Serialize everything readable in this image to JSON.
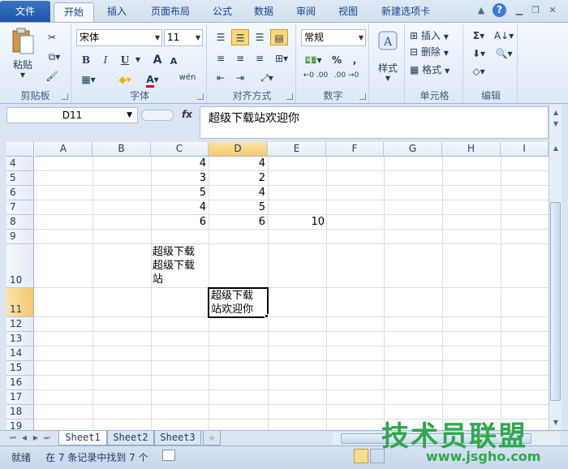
{
  "ribbon_tabs": [
    "文件",
    "开始",
    "插入",
    "页面布局",
    "公式",
    "数据",
    "审阅",
    "视图",
    "新建选项卡"
  ],
  "active_tab": "开始",
  "clipboard": {
    "paste_label": "粘贴",
    "group_label": "剪贴板"
  },
  "font": {
    "name": "宋体",
    "size": "11",
    "group_label": "字体",
    "bold": "B",
    "italic": "I",
    "underline": "U",
    "grow": "A",
    "shrink": "A",
    "wen": "wén"
  },
  "alignment": {
    "group_label": "对齐方式"
  },
  "number": {
    "format": "常规",
    "group_label": "数字",
    "percent": "%",
    "comma": ",",
    "inc_decimal": "←0 .00",
    "dec_decimal": ".00 →0"
  },
  "styles": {
    "label": "样式"
  },
  "cells": {
    "insert": "插入",
    "delete": "删除",
    "format": "格式",
    "group_label": "单元格"
  },
  "editing": {
    "group_label": "编辑"
  },
  "name_box": "D11",
  "fx": "fx",
  "formula_text": "超级下载站欢迎你",
  "columns": [
    "A",
    "B",
    "C",
    "D",
    "E",
    "F",
    "G",
    "H",
    "I"
  ],
  "rows": [
    "4",
    "5",
    "6",
    "7",
    "8",
    "9",
    "10",
    "11",
    "12",
    "13",
    "14",
    "15",
    "16",
    "17",
    "18",
    "19"
  ],
  "cell_values": {
    "c4": "4",
    "d4": "4",
    "c5": "3",
    "d5": "2",
    "c6": "5",
    "d6": "4",
    "c7": "4",
    "d7": "5",
    "c8": "6",
    "d8": "6",
    "e8": "10",
    "c10_line1": "超级下载",
    "c10_line2": "超级下载",
    "c10_line3": "站",
    "d11_line1": "超级下载",
    "d11_line2": "站欢迎你"
  },
  "sheets": [
    "Sheet1",
    "Sheet2",
    "Sheet3"
  ],
  "active_sheet": "Sheet1",
  "status": {
    "mode": "就绪",
    "message": "在 7 条记录中找到 7 个"
  },
  "watermark": {
    "line1": "技术员联盟",
    "line2": "www.jsgho.com"
  }
}
